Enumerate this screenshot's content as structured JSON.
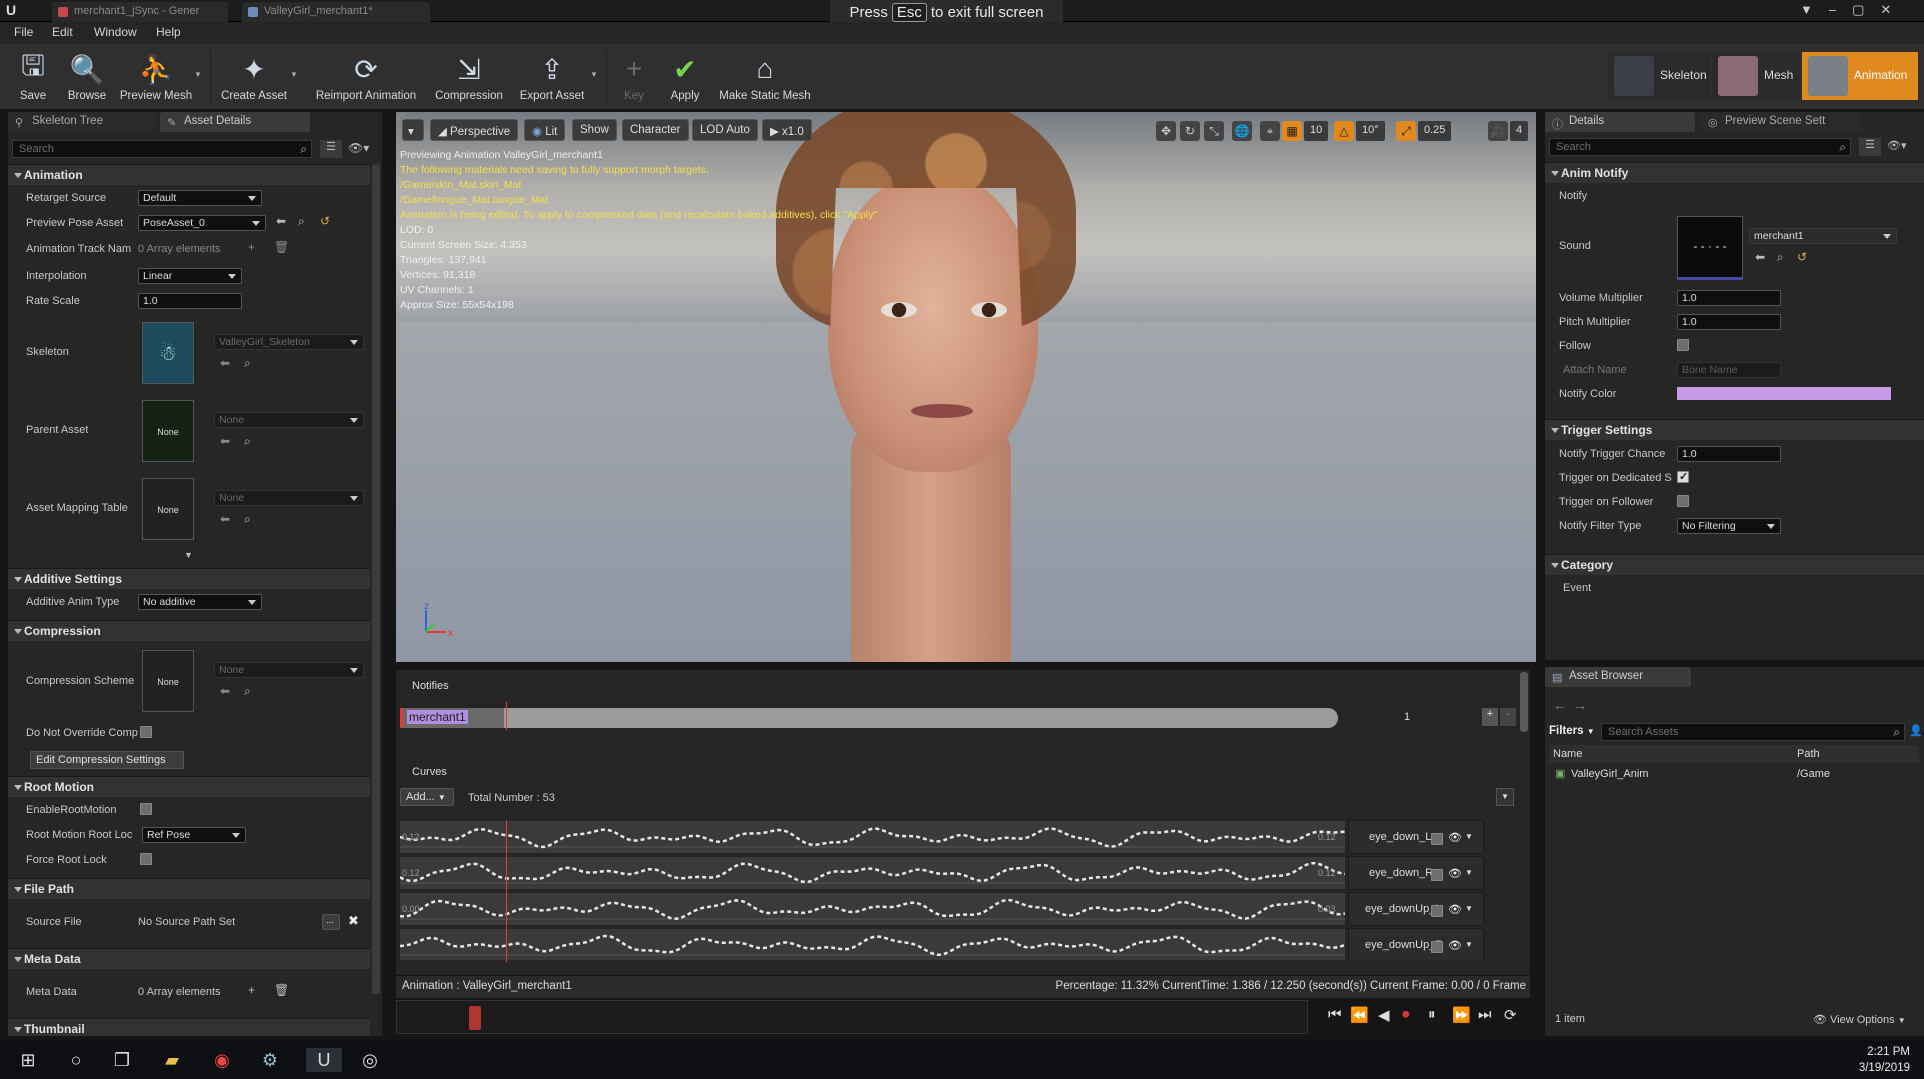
{
  "window_tabs": [
    {
      "label": "merchant1_jSync - Gener"
    },
    {
      "label": "ValleyGirl_merchant1*"
    }
  ],
  "fullscreen_banner": {
    "press": "Press",
    "key": "Esc",
    "rest": "to exit full screen"
  },
  "menu": [
    "File",
    "Edit",
    "Window",
    "Help"
  ],
  "toolbar": {
    "save": "Save",
    "browse": "Browse",
    "preview_mesh": "Preview Mesh",
    "create_asset": "Create Asset",
    "reimport": "Reimport Animation",
    "compression": "Compression",
    "export": "Export Asset",
    "key": "Key",
    "apply": "Apply",
    "make_static": "Make Static Mesh"
  },
  "modes": {
    "skeleton": "Skeleton",
    "mesh": "Mesh",
    "animation": "Animation"
  },
  "left_panel": {
    "tabs": [
      "Skeleton Tree",
      "Asset Details"
    ],
    "search_placeholder": "Search",
    "animation_cat": "Animation",
    "retarget_source_lbl": "Retarget Source",
    "retarget_source_val": "Default",
    "preview_pose_lbl": "Preview Pose Asset",
    "preview_pose_val": "PoseAsset_0",
    "anim_track_lbl": "Animation Track Nam",
    "anim_track_val": "0 Array elements",
    "interp_lbl": "Interpolation",
    "interp_val": "Linear",
    "rate_lbl": "Rate Scale",
    "rate_val": "1.0",
    "skeleton_lbl": "Skeleton",
    "skeleton_val": "ValleyGirl_Skeleton",
    "parent_lbl": "Parent Asset",
    "parent_val": "None",
    "parent_thumb": "None",
    "mapping_lbl": "Asset Mapping Table",
    "mapping_val": "None",
    "mapping_thumb": "None",
    "additive_cat": "Additive Settings",
    "additive_lbl": "Additive Anim Type",
    "additive_val": "No additive",
    "compression_cat": "Compression",
    "comp_scheme_lbl": "Compression Scheme",
    "comp_scheme_val": "None",
    "comp_thumb": "None",
    "no_override_lbl": "Do Not Override Comp",
    "edit_comp_btn": "Edit Compression Settings",
    "root_cat": "Root Motion",
    "enable_root_lbl": "EnableRootMotion",
    "root_lock_lbl": "Root Motion Root Loc",
    "root_lock_val": "Ref Pose",
    "force_root_lbl": "Force Root Lock",
    "filepath_cat": "File Path",
    "source_file_lbl": "Source File",
    "source_file_val": "No Source Path Set",
    "meta_cat": "Meta Data",
    "meta_lbl": "Meta Data",
    "meta_val": "0 Array elements",
    "thumb_cat": "Thumbnail"
  },
  "viewport": {
    "perspective": "Perspective",
    "lit": "Lit",
    "show": "Show",
    "character": "Character",
    "lod": "LOD Auto",
    "speed": "x1.0",
    "grid_val": "10",
    "angle_val": "10°",
    "scale_val": "0.25",
    "cam_val": "4",
    "overlay_white": "Previewing Animation ValleyGirl_merchant1",
    "overlay_yellow": [
      "The following materials need saving to fully support morph targets:",
      "/Game/skin_Mat.skin_Mat",
      "/Game/tongue_Mat.tongue_Mat",
      "Animation is being edited. To apply to compressed data (and recalculate baked additives), click \"Apply\""
    ],
    "overlay_stats": [
      "LOD: 0",
      "Current Screen Size: 4.353",
      "Triangles: 137,941",
      "Vertices: 91,318",
      "UV Channels: 1",
      "Approx Size: 55x54x198"
    ]
  },
  "timeline": {
    "notifies_lbl": "Notifies",
    "notify_name": "merchant1",
    "track_num": "1",
    "curves_lbl": "Curves",
    "add_btn": "Add...",
    "total": "Total Number : 53",
    "curves": [
      {
        "name": "eye_down_L",
        "lv": "0.12",
        "rv": "0.12"
      },
      {
        "name": "eye_down_R",
        "lv": "0.12",
        "rv": "0.12"
      },
      {
        "name": "eye_downUp_L",
        "lv": "0.00",
        "rv": "0.03"
      },
      {
        "name": "eye_downUp_R",
        "lv": "",
        "rv": ""
      }
    ],
    "status_left": "Animation :  ValleyGirl_merchant1",
    "status_right": "Percentage:  11.32% CurrentTime:  1.386 / 12.250 (second(s)) Current Frame:  0.00 / 0 Frame",
    "progress": 0.1132
  },
  "details": {
    "tabs": [
      "Details",
      "Preview Scene Sett"
    ],
    "search_placeholder": "Search",
    "anim_notify_cat": "Anim Notify",
    "notify_lbl": "Notify",
    "sound_lbl": "Sound",
    "sound_val": "merchant1",
    "volume_lbl": "Volume Multiplier",
    "volume_val": "1.0",
    "pitch_lbl": "Pitch Multiplier",
    "pitch_val": "1.0",
    "follow_lbl": "Follow",
    "attach_lbl": "Attach Name",
    "attach_val": "Bone Name",
    "notify_color_lbl": "Notify Color",
    "notify_color": "#c79ae8",
    "trigger_cat": "Trigger Settings",
    "chance_lbl": "Notify Trigger Chance",
    "chance_val": "1.0",
    "dedicated_lbl": "Trigger on Dedicated S",
    "follower_lbl": "Trigger on Follower",
    "filter_lbl": "Notify Filter Type",
    "filter_val": "No Filtering",
    "category_cat": "Category",
    "event_lbl": "Event"
  },
  "asset_browser": {
    "tab": "Asset Browser",
    "filters": "Filters",
    "search_placeholder": "Search Assets",
    "col_name": "Name",
    "col_path": "Path",
    "item_name": "ValleyGirl_Anim",
    "item_path": "/Game",
    "count": "1 item",
    "view_options": "View Options"
  },
  "taskbar": {
    "time": "2:21 PM",
    "date": "3/19/2019"
  },
  "colors": {
    "accent": "#e08a1e",
    "notify": "#c79ae8",
    "bg": "#262626"
  }
}
